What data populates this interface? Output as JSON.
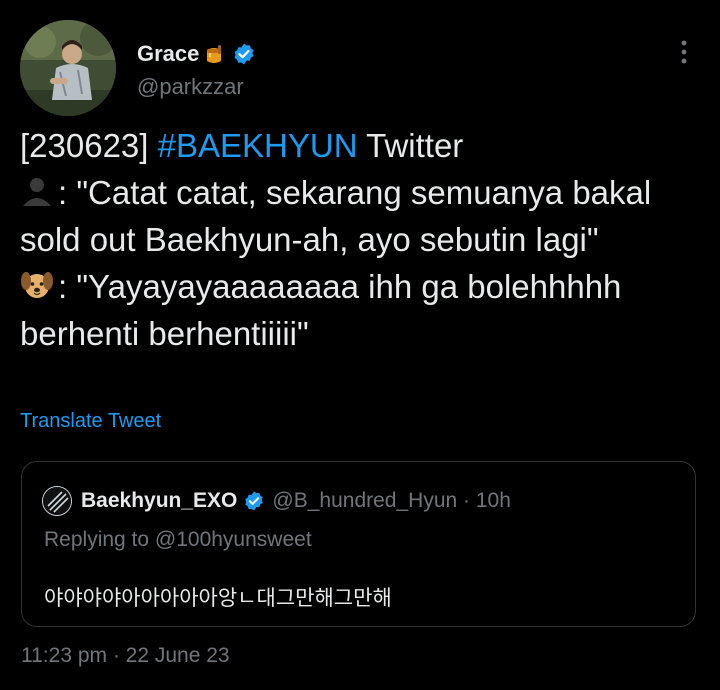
{
  "author": {
    "display_name": "Grace",
    "handle": "@parkzzar"
  },
  "tweet": {
    "line1_prefix": "[230623] ",
    "line1_hashtag": "#BAEKHYUN",
    "line1_suffix": " Twitter",
    "quote1_label": ": \"Catat catat, sekarang semuanya bakal sold out Baekhyun-ah, ayo sebutin lagi\"",
    "quote2_label": ": \"Yayayayaaaaaaaa ihh ga bolehhhhh berhenti berhentiiiii\""
  },
  "translate_label": "Translate Tweet",
  "quoted_tweet": {
    "name": "Baekhyun_EXO",
    "handle_time": "@B_hundred_Hyun · 10h",
    "replying_to": "Replying to @100hyunsweet",
    "text": "야야야야아아아아아앙ㄴ대그만해그만해"
  },
  "timestamp": "11:23 pm · 22 June 23",
  "icons": {
    "verified": "verified-badge-icon",
    "honey": "honey-pot-icon",
    "more": "more-options-icon",
    "silhouette": "bust-silhouette-icon",
    "dog": "dog-face-icon"
  },
  "colors": {
    "background": "#000000",
    "accent": "#1d9bf0",
    "text": "#e7e9ea",
    "muted": "#71767b"
  }
}
